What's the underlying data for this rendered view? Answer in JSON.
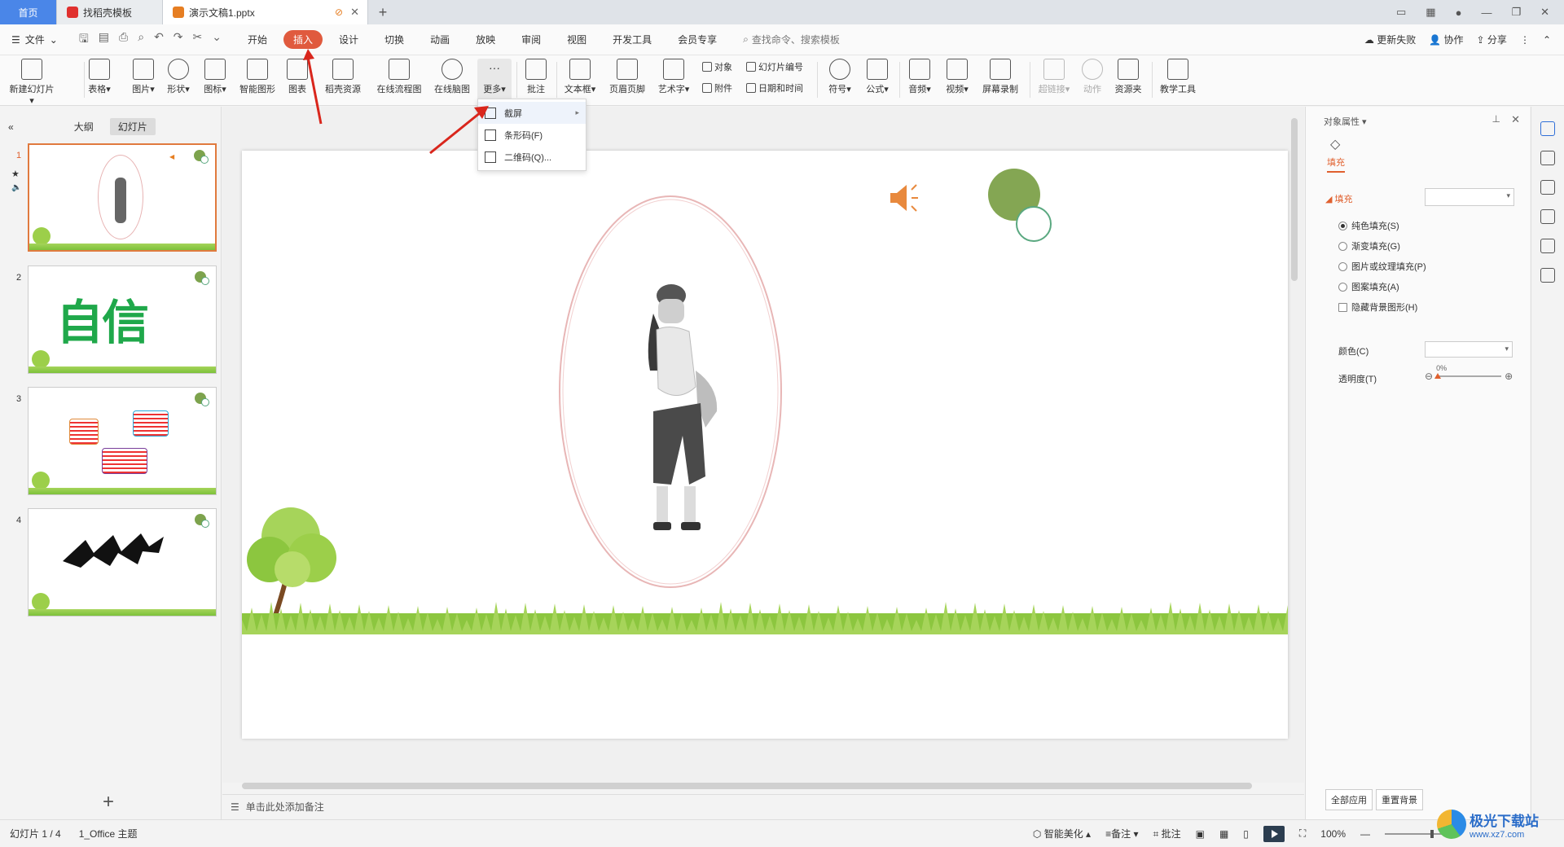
{
  "tabs": [
    {
      "label": "首页"
    },
    {
      "label": "找稻壳模板"
    },
    {
      "label": "演示文稿1.pptx"
    }
  ],
  "menubar": {
    "file": "文件",
    "items": [
      "开始",
      "插入",
      "设计",
      "切换",
      "动画",
      "放映",
      "审阅",
      "视图",
      "开发工具",
      "会员专享"
    ],
    "active": "插入",
    "search": "查找命令、搜索模板",
    "right": [
      "更新失败",
      "协作",
      "分享"
    ]
  },
  "ribbon": {
    "new_slide": "新建幻灯片",
    "table": "表格",
    "picture": "图片",
    "shape": "形状",
    "icon": "图标",
    "smart": "智能图形",
    "chart": "图表",
    "docer": "稻壳资源",
    "flow": "在线流程图",
    "mind": "在线脑图",
    "more": "更多",
    "comment": "批注",
    "textbox": "文本框",
    "header": "页眉页脚",
    "art": "艺术字",
    "object": "对象",
    "attach": "附件",
    "slide_num": "幻灯片编号",
    "datetime": "日期和时间",
    "symbol": "符号",
    "formula": "公式",
    "audio": "音频",
    "video": "视频",
    "screenrec": "屏幕录制",
    "hyperlink": "超链接",
    "action": "动作",
    "resource": "资源夹",
    "teach": "教学工具"
  },
  "dropdown": {
    "items": [
      "截屏",
      "条形码(F)",
      "二维码(Q)..."
    ]
  },
  "leftpanel": {
    "tab_outline": "大纲",
    "tab_slides": "幻灯片",
    "slides": [
      {
        "num": "1",
        "text": ""
      },
      {
        "num": "2",
        "text": "自信"
      },
      {
        "num": "3",
        "text": ""
      },
      {
        "num": "4",
        "text": ""
      }
    ]
  },
  "notes_placeholder": "单击此处添加备注",
  "rightpane": {
    "title": "对象属性",
    "tab": "填充",
    "section": "填充",
    "options": [
      "纯色填充(S)",
      "渐变填充(G)",
      "图片或纹理填充(P)",
      "图案填充(A)"
    ],
    "hide_bg": "隐藏背景图形(H)",
    "color_label": "颜色(C)",
    "transparency_label": "透明度(T)",
    "transparency_value": "0%",
    "apply_all": "全部应用",
    "reset_bg": "重置背景"
  },
  "status": {
    "slide_info": "幻灯片 1 / 4",
    "theme": "1_Office 主题",
    "beautify": "智能美化",
    "notes": "备注",
    "comments": "批注",
    "zoom": "100%"
  },
  "watermark": {
    "name": "极光下载站",
    "url": "www.xz7.com"
  },
  "colors": {
    "accent": "#e05a3e",
    "home_tab": "#4a86e8",
    "circle_green": "#7da34d",
    "grass": "#8cc63f"
  }
}
